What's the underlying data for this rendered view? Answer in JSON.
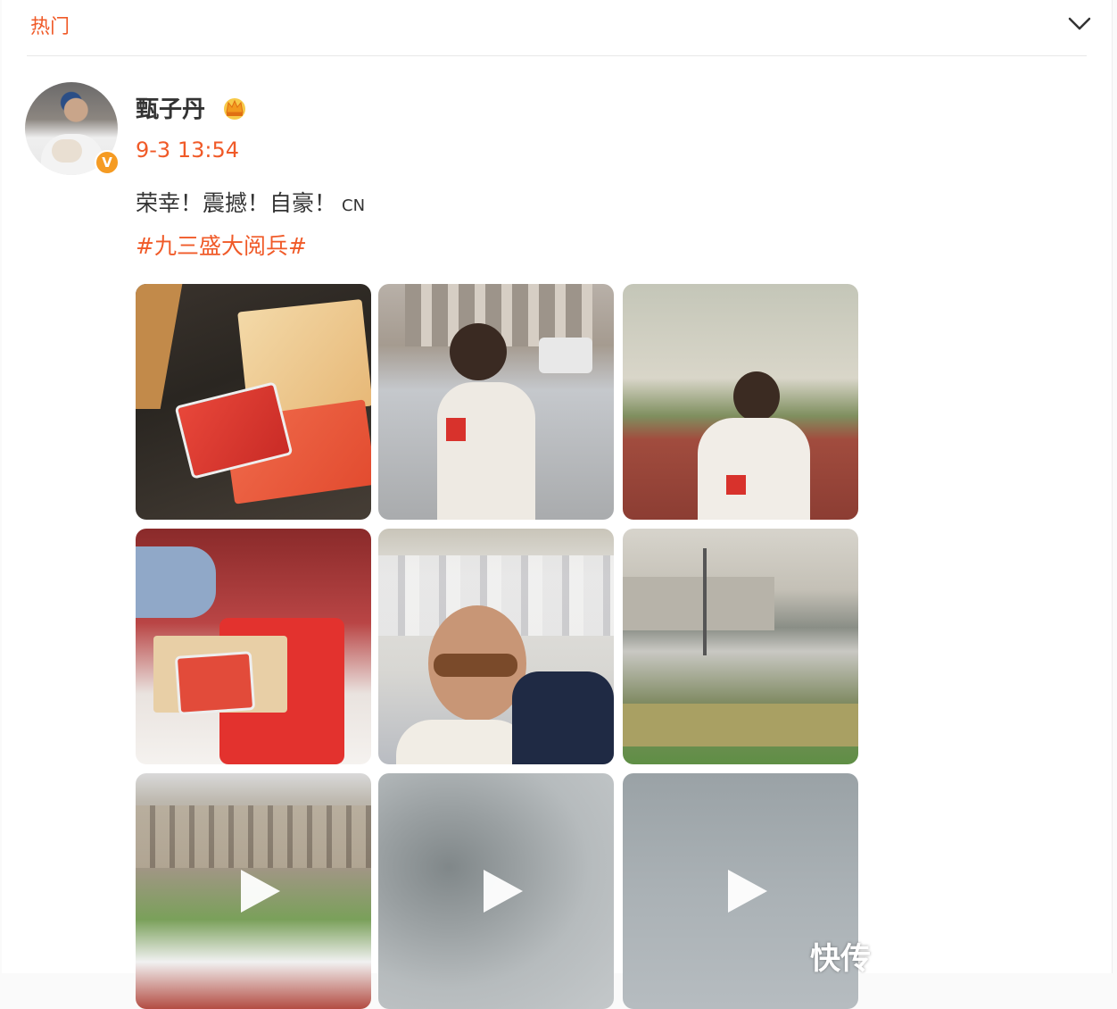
{
  "header": {
    "tab_label": "热门"
  },
  "post": {
    "username": "甄子丹",
    "timestamp": "9-3 13:54",
    "text": "荣幸！震撼！自豪！",
    "text_suffix": "CN",
    "hashtag": "#九三盛大阅兵#",
    "verified_badge": "V"
  },
  "media": [
    {
      "kind": "photo",
      "name": "credential-cards-photo"
    },
    {
      "kind": "photo",
      "name": "man-holding-card-photo"
    },
    {
      "kind": "photo",
      "name": "man-at-railing-photo"
    },
    {
      "kind": "photo",
      "name": "credential-in-hand-photo"
    },
    {
      "kind": "photo",
      "name": "selfie-in-crowd-photo"
    },
    {
      "kind": "photo",
      "name": "parade-square-photo"
    },
    {
      "kind": "video",
      "name": "hall-video"
    },
    {
      "kind": "video",
      "name": "sky-video-1"
    },
    {
      "kind": "video",
      "name": "sky-video-2"
    }
  ],
  "watermark": "快传",
  "colors": {
    "accent": "#f05a28",
    "gold": "#f59b23"
  }
}
